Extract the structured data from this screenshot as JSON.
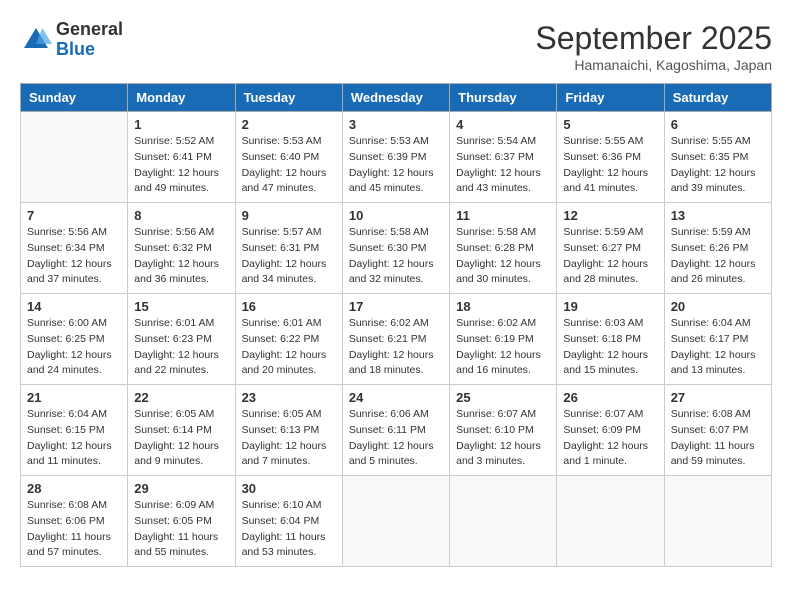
{
  "header": {
    "logo_general": "General",
    "logo_blue": "Blue",
    "month": "September 2025",
    "location": "Hamanaichi, Kagoshima, Japan"
  },
  "days_of_week": [
    "Sunday",
    "Monday",
    "Tuesday",
    "Wednesday",
    "Thursday",
    "Friday",
    "Saturday"
  ],
  "weeks": [
    [
      {
        "day": "",
        "sunrise": "",
        "sunset": "",
        "daylight": ""
      },
      {
        "day": "1",
        "sunrise": "5:52 AM",
        "sunset": "6:41 PM",
        "daylight": "12 hours and 49 minutes."
      },
      {
        "day": "2",
        "sunrise": "5:53 AM",
        "sunset": "6:40 PM",
        "daylight": "12 hours and 47 minutes."
      },
      {
        "day": "3",
        "sunrise": "5:53 AM",
        "sunset": "6:39 PM",
        "daylight": "12 hours and 45 minutes."
      },
      {
        "day": "4",
        "sunrise": "5:54 AM",
        "sunset": "6:37 PM",
        "daylight": "12 hours and 43 minutes."
      },
      {
        "day": "5",
        "sunrise": "5:55 AM",
        "sunset": "6:36 PM",
        "daylight": "12 hours and 41 minutes."
      },
      {
        "day": "6",
        "sunrise": "5:55 AM",
        "sunset": "6:35 PM",
        "daylight": "12 hours and 39 minutes."
      }
    ],
    [
      {
        "day": "7",
        "sunrise": "5:56 AM",
        "sunset": "6:34 PM",
        "daylight": "12 hours and 37 minutes."
      },
      {
        "day": "8",
        "sunrise": "5:56 AM",
        "sunset": "6:32 PM",
        "daylight": "12 hours and 36 minutes."
      },
      {
        "day": "9",
        "sunrise": "5:57 AM",
        "sunset": "6:31 PM",
        "daylight": "12 hours and 34 minutes."
      },
      {
        "day": "10",
        "sunrise": "5:58 AM",
        "sunset": "6:30 PM",
        "daylight": "12 hours and 32 minutes."
      },
      {
        "day": "11",
        "sunrise": "5:58 AM",
        "sunset": "6:28 PM",
        "daylight": "12 hours and 30 minutes."
      },
      {
        "day": "12",
        "sunrise": "5:59 AM",
        "sunset": "6:27 PM",
        "daylight": "12 hours and 28 minutes."
      },
      {
        "day": "13",
        "sunrise": "5:59 AM",
        "sunset": "6:26 PM",
        "daylight": "12 hours and 26 minutes."
      }
    ],
    [
      {
        "day": "14",
        "sunrise": "6:00 AM",
        "sunset": "6:25 PM",
        "daylight": "12 hours and 24 minutes."
      },
      {
        "day": "15",
        "sunrise": "6:01 AM",
        "sunset": "6:23 PM",
        "daylight": "12 hours and 22 minutes."
      },
      {
        "day": "16",
        "sunrise": "6:01 AM",
        "sunset": "6:22 PM",
        "daylight": "12 hours and 20 minutes."
      },
      {
        "day": "17",
        "sunrise": "6:02 AM",
        "sunset": "6:21 PM",
        "daylight": "12 hours and 18 minutes."
      },
      {
        "day": "18",
        "sunrise": "6:02 AM",
        "sunset": "6:19 PM",
        "daylight": "12 hours and 16 minutes."
      },
      {
        "day": "19",
        "sunrise": "6:03 AM",
        "sunset": "6:18 PM",
        "daylight": "12 hours and 15 minutes."
      },
      {
        "day": "20",
        "sunrise": "6:04 AM",
        "sunset": "6:17 PM",
        "daylight": "12 hours and 13 minutes."
      }
    ],
    [
      {
        "day": "21",
        "sunrise": "6:04 AM",
        "sunset": "6:15 PM",
        "daylight": "12 hours and 11 minutes."
      },
      {
        "day": "22",
        "sunrise": "6:05 AM",
        "sunset": "6:14 PM",
        "daylight": "12 hours and 9 minutes."
      },
      {
        "day": "23",
        "sunrise": "6:05 AM",
        "sunset": "6:13 PM",
        "daylight": "12 hours and 7 minutes."
      },
      {
        "day": "24",
        "sunrise": "6:06 AM",
        "sunset": "6:11 PM",
        "daylight": "12 hours and 5 minutes."
      },
      {
        "day": "25",
        "sunrise": "6:07 AM",
        "sunset": "6:10 PM",
        "daylight": "12 hours and 3 minutes."
      },
      {
        "day": "26",
        "sunrise": "6:07 AM",
        "sunset": "6:09 PM",
        "daylight": "12 hours and 1 minute."
      },
      {
        "day": "27",
        "sunrise": "6:08 AM",
        "sunset": "6:07 PM",
        "daylight": "11 hours and 59 minutes."
      }
    ],
    [
      {
        "day": "28",
        "sunrise": "6:08 AM",
        "sunset": "6:06 PM",
        "daylight": "11 hours and 57 minutes."
      },
      {
        "day": "29",
        "sunrise": "6:09 AM",
        "sunset": "6:05 PM",
        "daylight": "11 hours and 55 minutes."
      },
      {
        "day": "30",
        "sunrise": "6:10 AM",
        "sunset": "6:04 PM",
        "daylight": "11 hours and 53 minutes."
      },
      {
        "day": "",
        "sunrise": "",
        "sunset": "",
        "daylight": ""
      },
      {
        "day": "",
        "sunrise": "",
        "sunset": "",
        "daylight": ""
      },
      {
        "day": "",
        "sunrise": "",
        "sunset": "",
        "daylight": ""
      },
      {
        "day": "",
        "sunrise": "",
        "sunset": "",
        "daylight": ""
      }
    ]
  ]
}
